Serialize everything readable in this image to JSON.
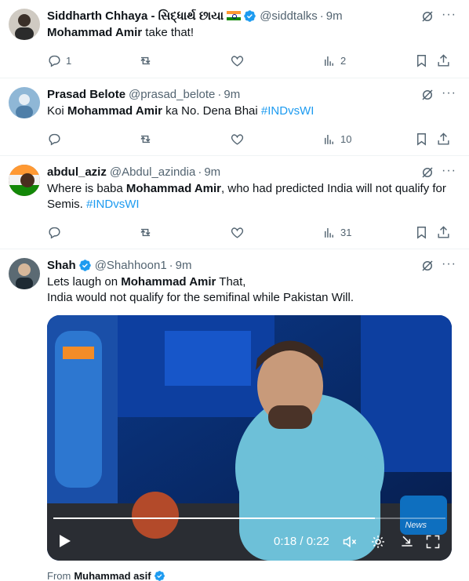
{
  "colors": {
    "accent": "#1d9bf0",
    "muted": "#536471",
    "text": "#0f1419",
    "divider": "#eff3f4"
  },
  "tweets": [
    {
      "name": "Siddharth Chhaya - સિદ્ધાર્થ છાયા",
      "handle": "@siddtalks",
      "sep": "·",
      "time": "9m",
      "text_prefix": "",
      "text_bold": "Mohammad Amir",
      "text_suffix": " take that!",
      "replies": "1",
      "reposts": "",
      "likes": "",
      "views": "2"
    },
    {
      "name": "Prasad Belote",
      "handle": "@prasad_belote",
      "sep": "·",
      "time": "9m",
      "text_prefix": "Koi ",
      "text_bold": "Mohammad Amir",
      "text_suffix": " ka No. Dena Bhai ",
      "hashtag": "#INDvsWI",
      "replies": "",
      "reposts": "",
      "likes": "",
      "views": "10"
    },
    {
      "name": "abdul_aziz",
      "handle": "@Abdul_azindia",
      "sep": "·",
      "time": "9m",
      "text_prefix": "Where is baba ",
      "text_bold": "Mohammad Amir",
      "text_suffix": ", who had predicted India will not qualify for Semis. ",
      "hashtag": "#INDvsWI",
      "replies": "",
      "reposts": "",
      "likes": "",
      "views": "31"
    },
    {
      "name": "Shah",
      "handle": "@Shahhoon1",
      "sep": "·",
      "time": "9m",
      "text_prefix": "Lets laugh on ",
      "text_bold": "Mohammad Amir",
      "text_suffix": " That,",
      "text_line2": "India would not qualify for the semifinal while Pakistan Will.",
      "video": {
        "time_display": "0:18 / 0:22",
        "progress": 0.82,
        "watermark": "News"
      },
      "from_label": "From",
      "from_name": "Muhammad asif"
    }
  ]
}
